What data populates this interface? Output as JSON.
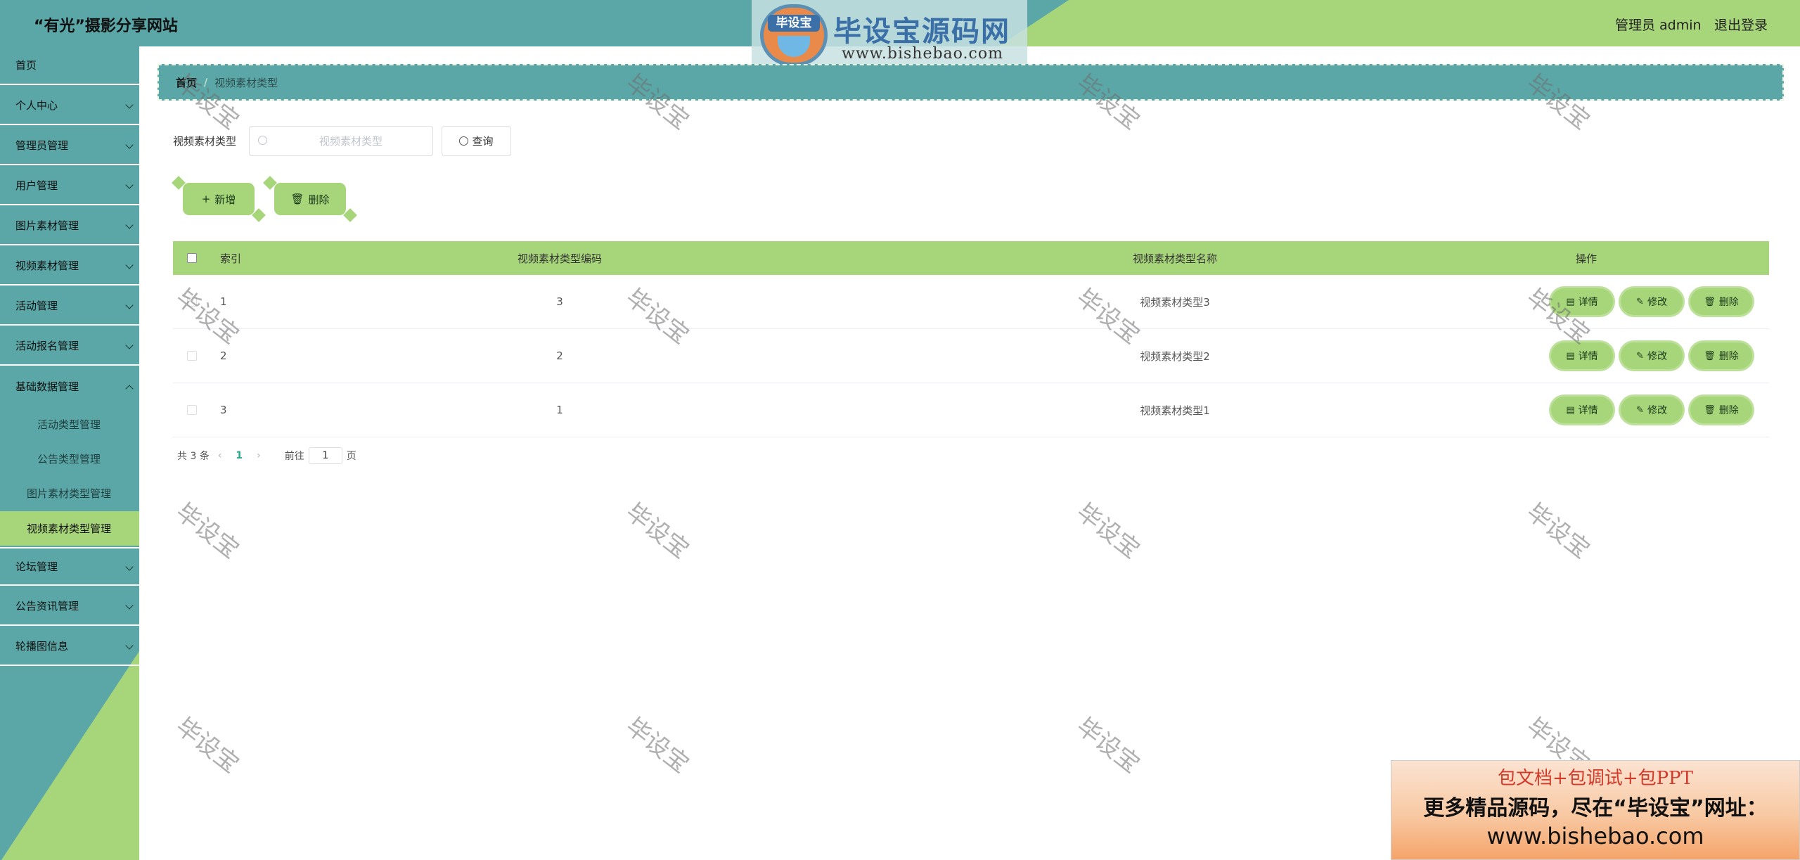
{
  "header": {
    "site_title": "“有光”摄影分享网站",
    "admin_text": "管理员 admin",
    "logout": "退出登录"
  },
  "logo": {
    "badge_text": "毕设宝",
    "main_text": "毕设宝源码网",
    "url": "www.bishebao.com"
  },
  "sidebar": {
    "items": [
      {
        "label": "首页"
      },
      {
        "label": "个人中心"
      },
      {
        "label": "管理员管理"
      },
      {
        "label": "用户管理"
      },
      {
        "label": "图片素材管理"
      },
      {
        "label": "视频素材管理"
      },
      {
        "label": "活动管理"
      },
      {
        "label": "活动报名管理"
      },
      {
        "label": "基础数据管理"
      },
      {
        "label": "论坛管理"
      },
      {
        "label": "公告资讯管理"
      },
      {
        "label": "轮播图信息"
      }
    ],
    "subitems": [
      {
        "label": "活动类型管理"
      },
      {
        "label": "公告类型管理"
      },
      {
        "label": "图片素材类型管理"
      },
      {
        "label": "视频素材类型管理"
      }
    ]
  },
  "breadcrumb": {
    "home": "首页",
    "current": "视频素材类型"
  },
  "search": {
    "label": "视频素材类型",
    "placeholder": "视频素材类型",
    "button": "查询"
  },
  "actions": {
    "add": "新增",
    "delete": "删除"
  },
  "table": {
    "columns": [
      "索引",
      "视频素材类型编码",
      "视频素材类型名称",
      "操作"
    ],
    "rows": [
      {
        "index": "1",
        "code": "3",
        "name": "视频素材类型3"
      },
      {
        "index": "2",
        "code": "2",
        "name": "视频素材类型2"
      },
      {
        "index": "3",
        "code": "1",
        "name": "视频素材类型1"
      }
    ],
    "ops": {
      "detail": "详情",
      "edit": "修改",
      "delete": "删除"
    }
  },
  "pagination": {
    "total": "共 3 条",
    "current_page": "1",
    "goto_prefix": "前往",
    "goto_value": "1",
    "goto_suffix": "页"
  },
  "watermark": "毕设宝",
  "ad": {
    "line1": "包文档+包调试+包PPT",
    "line2": "更多精品源码，尽在“毕设宝”网址：",
    "line3": "www.bishebao.com"
  },
  "colors": {
    "teal": "#5ba7a7",
    "green": "#a7d57a",
    "page_link": "#2ba88c"
  }
}
